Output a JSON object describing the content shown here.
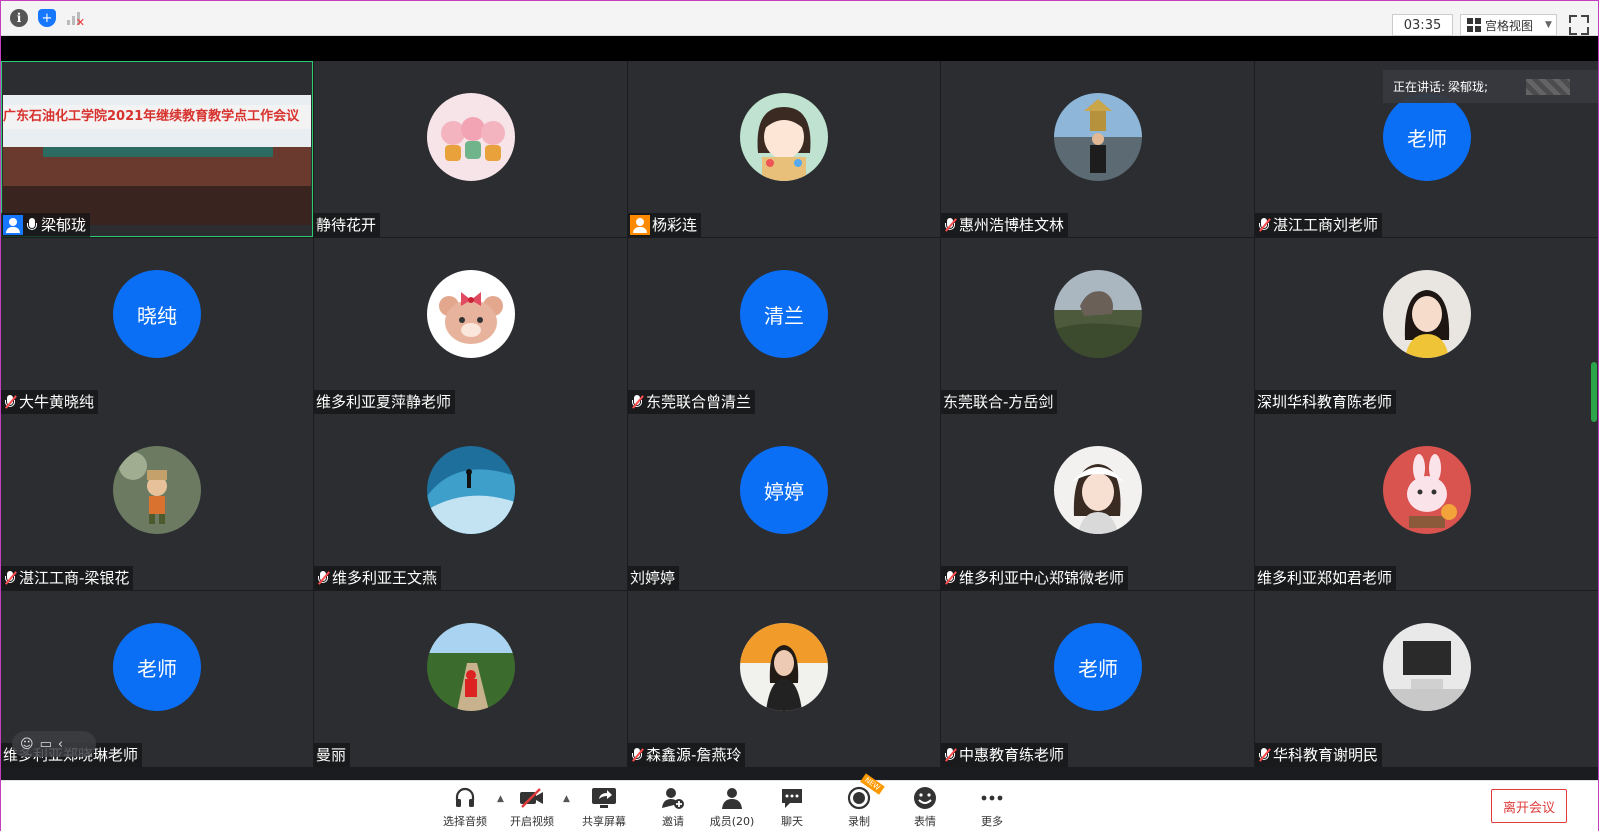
{
  "topbar": {
    "timer": "03:35",
    "view_label": "宫格视图"
  },
  "speaking": {
    "prefix": "正在讲话:",
    "name": "梁郁珑;"
  },
  "participants": [
    {
      "name": "梁郁珑",
      "mic": "on",
      "host": "blue",
      "type": "video",
      "video_banner": "广东石油化工学院2021年继续教育教学点工作会议"
    },
    {
      "name": "静待花开",
      "mic": "none",
      "type": "photo",
      "photo": "pigs"
    },
    {
      "name": "杨彩连",
      "mic": "none",
      "host": "orange",
      "type": "photo",
      "photo": "girl"
    },
    {
      "name": "惠州浩博桂文林",
      "mic": "muted",
      "type": "photo",
      "photo": "man"
    },
    {
      "name": "湛江工商刘老师",
      "mic": "muted",
      "type": "text",
      "avatar_text": "老师"
    },
    {
      "name": "大牛黄晓纯",
      "mic": "muted",
      "type": "text",
      "avatar_text": "晓纯"
    },
    {
      "name": "维多利亚夏萍静老师",
      "mic": "none",
      "type": "photo",
      "photo": "bear"
    },
    {
      "name": "东莞联合曾清兰",
      "mic": "muted",
      "type": "text",
      "avatar_text": "清兰"
    },
    {
      "name": "东莞联合-方岳剑",
      "mic": "none",
      "type": "photo",
      "photo": "rock"
    },
    {
      "name": "深圳华科教育陈老师",
      "mic": "none",
      "type": "photo",
      "photo": "woman"
    },
    {
      "name": "湛江工商-梁银花",
      "mic": "muted",
      "type": "photo",
      "photo": "toy"
    },
    {
      "name": "维多利亚王文燕",
      "mic": "muted",
      "type": "photo",
      "photo": "surf"
    },
    {
      "name": "刘婷婷",
      "mic": "none",
      "type": "text",
      "avatar_text": "婷婷"
    },
    {
      "name": "维多利亚中心郑锦微老师",
      "mic": "muted",
      "type": "photo",
      "photo": "girl2"
    },
    {
      "name": "维多利亚郑如君老师",
      "mic": "none",
      "type": "photo",
      "photo": "bunny"
    },
    {
      "name": "维多利亚郑晓琳老师",
      "mic": "none",
      "type": "text",
      "avatar_text": "老师"
    },
    {
      "name": "曼丽",
      "mic": "none",
      "type": "photo",
      "photo": "path"
    },
    {
      "name": "森鑫源-詹燕玲",
      "mic": "muted",
      "type": "photo",
      "photo": "lady"
    },
    {
      "name": "中惠教育练老师",
      "mic": "muted",
      "type": "text",
      "avatar_text": "老师"
    },
    {
      "name": "华科教育谢明民",
      "mic": "muted",
      "type": "photo",
      "photo": "room"
    }
  ],
  "toolbar": {
    "audio": "选择音频",
    "video": "开启视频",
    "share": "共享屏幕",
    "invite": "邀请",
    "members": "成员(20)",
    "chat": "聊天",
    "record": "录制",
    "reaction": "表情",
    "more": "更多",
    "leave": "离开会议",
    "new_badge": "NEW"
  },
  "colors": {
    "accent_blue": "#0a6ff5",
    "tile_bg": "#2b2d31",
    "leave_red": "#e03c3c"
  }
}
